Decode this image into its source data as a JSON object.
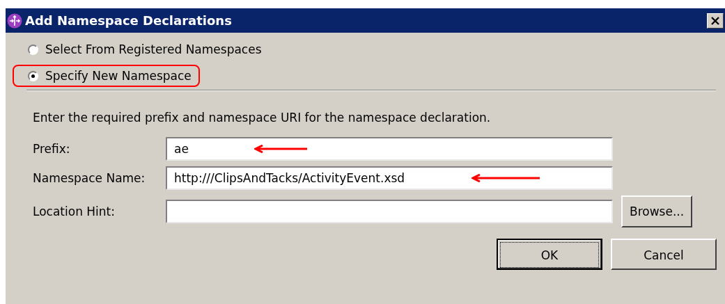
{
  "window": {
    "title": "Add Namespace Declarations"
  },
  "radios": [
    {
      "label": "Select From Registered Namespaces",
      "selected": false,
      "highlighted": false
    },
    {
      "label": "Specify New Namespace",
      "selected": true,
      "highlighted": true
    }
  ],
  "instruction": "Enter the required prefix and namespace URI for the namespace declaration.",
  "fields": [
    {
      "label": "Prefix:",
      "value": "ae",
      "arrow": true
    },
    {
      "label": "Namespace Name:",
      "value": "http:///ClipsAndTacks/ActivityEvent.xsd",
      "arrow": true
    },
    {
      "label": "Location Hint:",
      "arrow": false,
      "button": "Browse..."
    }
  ],
  "buttons": [
    {
      "label": "OK",
      "default": true
    },
    {
      "label": "Cancel",
      "default": false
    }
  ]
}
